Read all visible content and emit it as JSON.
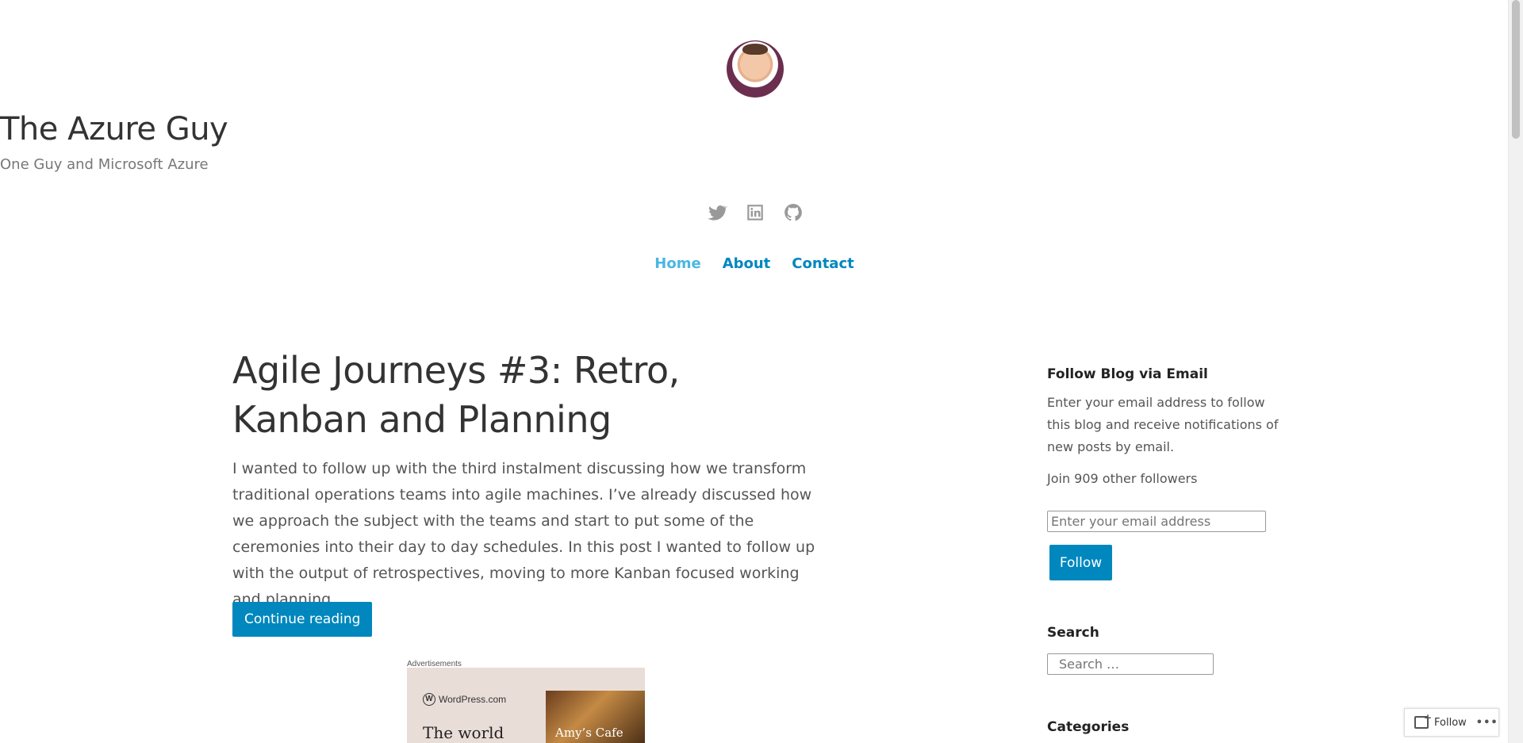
{
  "site": {
    "title": "The Azure Guy",
    "tagline": "One Guy and Microsoft Azure"
  },
  "social": [
    {
      "icon": "twitter-icon"
    },
    {
      "icon": "linkedin-icon"
    },
    {
      "icon": "github-icon"
    }
  ],
  "nav": {
    "items": [
      "Home",
      "About",
      "Contact"
    ],
    "current": "Home"
  },
  "post": {
    "title": "Agile Journeys #3: Retro, Kanban and Planning",
    "excerpt": "I wanted to follow up with the third instalment discussing how we transform traditional operations teams into agile machines. I’ve already discussed how we approach the subject with the teams and start to put some of the ceremonies into their day to day schedules. In this post I wanted to follow up with the output of retrospectives, moving to more Kanban focused working and planning.",
    "continue_label": "Continue reading"
  },
  "ad": {
    "label": "Advertisements",
    "brand": "WordPress.com",
    "headline": "The world",
    "photo_caption": "Amy’s Cafe"
  },
  "sidebar": {
    "follow_title": "Follow Blog via Email",
    "follow_text": "Enter your email address to follow this blog and receive notifications of new posts by email.",
    "followers_text": "Join 909 other followers",
    "email_placeholder": "Enter your email address",
    "follow_button": "Follow",
    "search_title": "Search",
    "search_placeholder": "Search …",
    "categories_title": "Categories"
  },
  "floating": {
    "follow_label": "Follow",
    "more_label": "•••"
  },
  "colors": {
    "accent": "#0087be",
    "nav_current": "#4ab7e0",
    "text": "#333333",
    "muted": "#777777"
  }
}
